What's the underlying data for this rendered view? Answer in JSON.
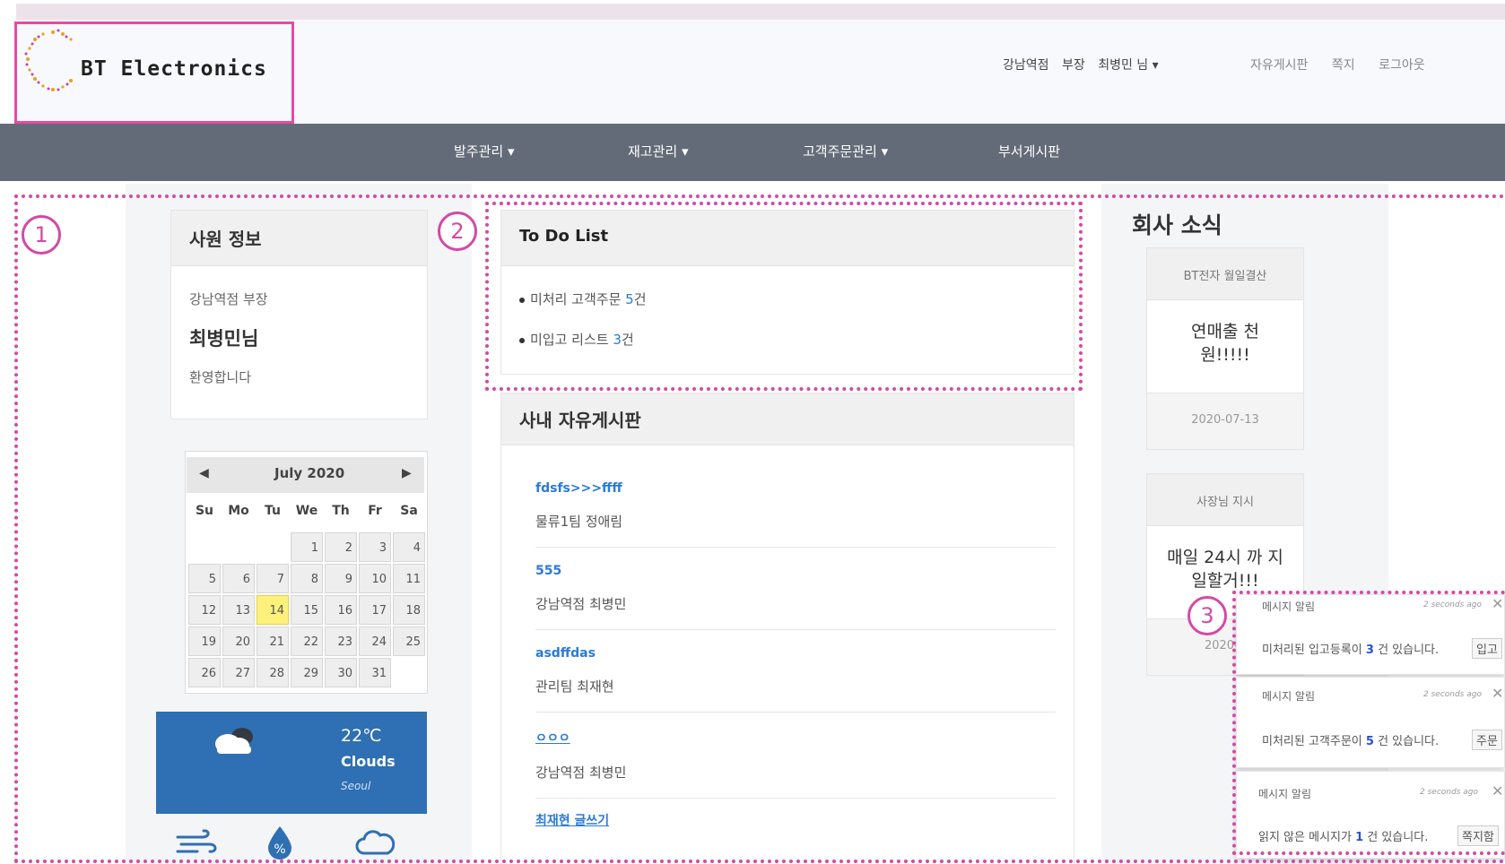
{
  "brand": {
    "name": "BT Electronics"
  },
  "user_menu": {
    "branch": "강남역점",
    "position": "부장",
    "user": "최병민 님 ▾"
  },
  "top_links": [
    "자유게시판",
    "쪽지",
    "로그아웃"
  ],
  "nav": [
    "발주관리 ▾",
    "재고관리 ▾",
    "고객주문관리 ▾",
    "부서게시판"
  ],
  "markers": [
    "1",
    "2",
    "3"
  ],
  "employee": {
    "title": "사원 정보",
    "dept": "강남역점 부장",
    "name": "최병민님",
    "greeting": "환영합니다"
  },
  "calendar": {
    "month": "July 2020",
    "prev": "◀",
    "next": "▶",
    "dow": [
      "Su",
      "Mo",
      "Tu",
      "We",
      "Th",
      "Fr",
      "Sa"
    ],
    "weeks": [
      [
        "",
        "",
        "",
        "1",
        "2",
        "3",
        "4"
      ],
      [
        "5",
        "6",
        "7",
        "8",
        "9",
        "10",
        "11"
      ],
      [
        "12",
        "13",
        "14",
        "15",
        "16",
        "17",
        "18"
      ],
      [
        "19",
        "20",
        "21",
        "22",
        "23",
        "24",
        "25"
      ],
      [
        "26",
        "27",
        "28",
        "29",
        "30",
        "31",
        ""
      ]
    ],
    "today": "14"
  },
  "weather": {
    "temp": "22℃",
    "desc": "Clouds",
    "city": "Seoul"
  },
  "todo": {
    "title": "To Do List",
    "items": [
      {
        "text": "미처리 고객주문 ",
        "count": "5",
        "unit": "건"
      },
      {
        "text": "미입고 리스트 ",
        "count": "3",
        "unit": "건"
      }
    ]
  },
  "board": {
    "title": "사내 자유게시판",
    "posts": [
      {
        "title": "fdsfs>>>ffff",
        "author": "물류1팀 정애림"
      },
      {
        "title": "555",
        "author": "강남역점 최병민"
      },
      {
        "title": "asdffdas",
        "author": "관리팀 최재현"
      },
      {
        "title": "ㅇㅇㅇ",
        "author": "강남역점 최병민"
      },
      {
        "title": "최재현 글쓰기",
        "author": ""
      }
    ]
  },
  "news": {
    "title": "회사 소식",
    "items": [
      {
        "header": "BT전자 월일결산",
        "body": "연매출 천 원!!!!!",
        "date": "2020-07-13"
      },
      {
        "header": "사장님 지시",
        "body": "매일 24시 까 지 일할거!!!",
        "date": "2020-0"
      }
    ]
  },
  "notifications": [
    {
      "title": "메시지 알림",
      "time": "2 seconds ago",
      "pre": "미처리된 입고등록이 ",
      "count": "3",
      "post": " 건 있습니다.",
      "action": "입고"
    },
    {
      "title": "메시지 알림",
      "time": "2 seconds ago",
      "pre": "미처리된 고객주문이 ",
      "count": "5",
      "post": " 건 있습니다.",
      "action": "주문"
    },
    {
      "title": "메시지 알림",
      "time": "2 seconds ago",
      "pre": "읽지 않은 메시지가 ",
      "count": "1",
      "post": " 건 있습니다.",
      "action": "쪽지함"
    }
  ],
  "colors": {
    "accent": "#d24aa6",
    "navbar": "#646b78",
    "link": "#2a7ad8",
    "weather_bg": "#2f6fb3",
    "today": "#fdf17c"
  },
  "icons": [
    "wind-icon",
    "humidity-icon",
    "cloud-icon",
    "cloud-sun-icon",
    "close-icon"
  ]
}
